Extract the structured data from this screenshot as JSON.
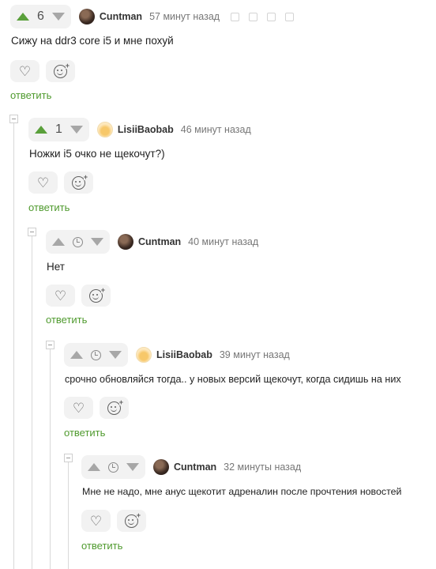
{
  "comments": [
    {
      "rating": "6",
      "author": "Cuntman",
      "time": "57 минут назад",
      "text": "Сижу на ddr3 core i5 и мне похуй",
      "reply": "ответить",
      "avatar": "dark-photo-avatar",
      "vote_up_active": true
    },
    {
      "rating": "1",
      "author": "LisiiBaobab",
      "time": "46 минут назад",
      "text": "Ножки i5 очко не щекочут?)",
      "reply": "ответить",
      "avatar": "yellow-lamp-avatar",
      "vote_up_active": true
    },
    {
      "rating": "",
      "author": "Cuntman",
      "time": "40 минут назад",
      "text": "Нет",
      "reply": "ответить",
      "avatar": "dark-photo-avatar",
      "rating_icon": "clock-icon"
    },
    {
      "rating": "",
      "author": "LisiiBaobab",
      "time": "39 минут назад",
      "text": "срочно обновляйся тогда.. у новых версий щекочут, когда сидишь на них",
      "reply": "ответить",
      "avatar": "yellow-lamp-avatar",
      "rating_icon": "clock-icon"
    },
    {
      "rating": "",
      "author": "Cuntman",
      "time": "32 минуты назад",
      "text": "Мне не надо, мне анус щекотит адреналин после прочтения новостей",
      "reply": "ответить",
      "avatar": "dark-photo-avatar",
      "rating_icon": "clock-icon"
    }
  ],
  "colors": {
    "accent_green": "#5aa03b",
    "reply_link": "#4f9a2e",
    "pill_bg": "#f2f2f2",
    "text": "#1f1f1f",
    "muted": "#777777"
  },
  "icons": {
    "like": "heart-icon",
    "react": "smile-plus-icon",
    "vote_up": "arrow-up-icon",
    "vote_down": "arrow-down-icon",
    "collapse": "minus-box-icon",
    "header_actions": [
      "share-icon",
      "edit-icon",
      "save-icon",
      "flag-icon"
    ]
  }
}
